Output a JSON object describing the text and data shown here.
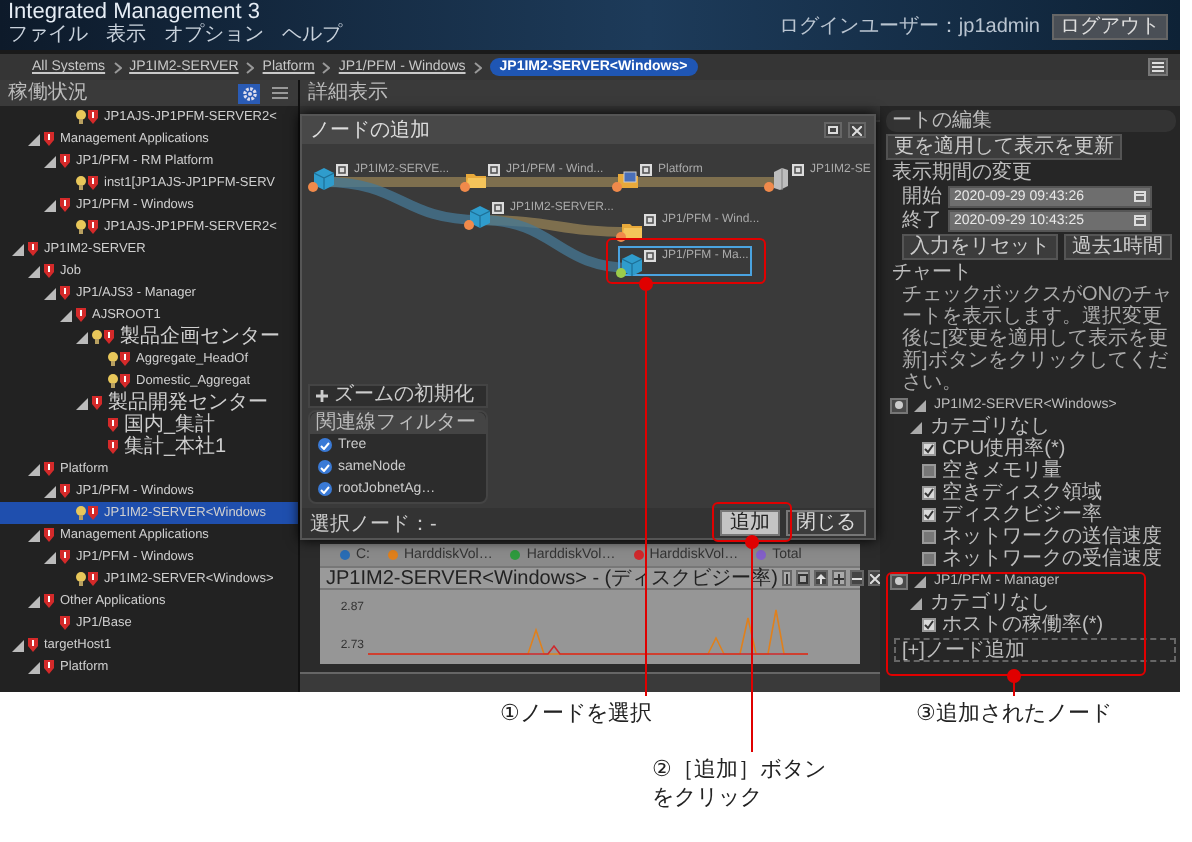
{
  "window": {
    "title": "Integrated Management 3",
    "user": "ログインユーザー：jp1admin",
    "logout": "ログアウト"
  },
  "menu": [
    "ファイル",
    "表示",
    "オプション",
    "ヘルプ"
  ],
  "breadcrumbs": [
    {
      "label": "All Systems",
      "selected": false
    },
    {
      "label": "JP1IM2-SERVER",
      "selected": false
    },
    {
      "label": "Platform",
      "selected": false
    },
    {
      "label": "JP1/PFM - Windows",
      "selected": false
    },
    {
      "label": "JP1IM2-SERVER<Windows>",
      "selected": true
    }
  ],
  "status_panel": {
    "title": "稼働状況",
    "tree": [
      {
        "children": [
          {
            "children": [
              {
                "children": [
                  {
                    "label": "JP1AJS-JP1PFM-SERVER2<",
                    "lamp": true,
                    "selected": false
                  }
                ]
              }
            ]
          },
          {
            "label": "Management Applications",
            "expanded": true,
            "lamp": false,
            "selected": false,
            "children": [
              {
                "label": "JP1/PFM - RM Platform",
                "expanded": true,
                "lamp": false,
                "selected": false,
                "children": [
                  {
                    "label": "inst1[JP1AJS-JP1PFM-SERV",
                    "lamp": true,
                    "selected": false
                  }
                ]
              },
              {
                "label": "JP1/PFM - Windows",
                "expanded": true,
                "lamp": false,
                "selected": false,
                "children": [
                  {
                    "label": "JP1AJS-JP1PFM-SERVER2<",
                    "lamp": true,
                    "selected": false
                  }
                ]
              }
            ]
          }
        ]
      },
      {
        "label": "JP1IM2-SERVER",
        "expanded": true,
        "lamp": false,
        "selected": false,
        "children": [
          {
            "label": "Job",
            "expanded": true,
            "lamp": false,
            "selected": false,
            "children": [
              {
                "label": "JP1/AJS3 - Manager",
                "expanded": true,
                "lamp": false,
                "selected": false,
                "children": [
                  {
                    "label": "AJSROOT1",
                    "expanded": true,
                    "lamp": false,
                    "selected": false,
                    "children": [
                      {
                        "label": "製品企画センター",
                        "expanded": true,
                        "lamp": true,
                        "selected": false,
                        "children": [
                          {
                            "label": "Aggregate_HeadOf",
                            "lamp": true,
                            "selected": false
                          },
                          {
                            "label": "Domestic_Aggregat",
                            "lamp": true,
                            "selected": false
                          }
                        ]
                      },
                      {
                        "label": "製品開発センター",
                        "expanded": true,
                        "lamp": false,
                        "selected": false,
                        "children": [
                          {
                            "label": "国内_集計",
                            "lamp": false,
                            "selected": false
                          },
                          {
                            "label": "集計_本社1",
                            "lamp": false,
                            "selected": false
                          }
                        ]
                      }
                    ]
                  }
                ]
              }
            ]
          },
          {
            "label": "Platform",
            "expanded": true,
            "lamp": false,
            "selected": false,
            "children": [
              {
                "label": "JP1/PFM - Windows",
                "expanded": true,
                "lamp": false,
                "selected": false,
                "children": [
                  {
                    "label": "JP1IM2-SERVER<Windows",
                    "lamp": true,
                    "selected": true
                  }
                ]
              }
            ]
          },
          {
            "label": "Management Applications",
            "expanded": true,
            "lamp": false,
            "selected": false,
            "children": [
              {
                "label": "JP1/PFM - Windows",
                "expanded": true,
                "lamp": false,
                "selected": false,
                "children": [
                  {
                    "label": "JP1IM2-SERVER<Windows>",
                    "lamp": true,
                    "selected": false
                  }
                ]
              }
            ]
          },
          {
            "label": "Other Applications",
            "expanded": true,
            "lamp": false,
            "selected": false,
            "children": [
              {
                "label": "JP1/Base",
                "lamp": false,
                "selected": false
              }
            ]
          }
        ]
      },
      {
        "label": "targetHost1",
        "expanded": true,
        "lamp": false,
        "selected": false,
        "children": [
          {
            "label": "Platform",
            "expanded": true,
            "lamp": false,
            "selected": false
          }
        ]
      }
    ]
  },
  "detail_panel": {
    "title": "詳細表示",
    "chart": {
      "legend": [
        {
          "label": "C:",
          "color": "#2a6db5"
        },
        {
          "label": "HarddiskVol…",
          "color": "#e0801c"
        },
        {
          "label": "HarddiskVol…",
          "color": "#2f9a3e"
        },
        {
          "label": "HarddiskVol…",
          "color": "#d0282c"
        },
        {
          "label": "Total",
          "color": "#8360c8"
        }
      ],
      "title": "JP1IM2-SERVER<Windows> - (ディスクビジー率)",
      "y_ticks": [
        "2.87",
        "2.73"
      ]
    }
  },
  "dialog": {
    "title": "ノードの追加",
    "nodes": [
      {
        "label": "JP1IM2-SERVE...",
        "kind": "cube",
        "color": "#f08a4b",
        "selected": false
      },
      {
        "label": "JP1/PFM - Wind...",
        "kind": "folder",
        "color": "#f08a4b",
        "selected": false
      },
      {
        "label": "Platform",
        "kind": "monitor",
        "color": "#f08a4b",
        "selected": false
      },
      {
        "label": "JP1IM2-SE",
        "kind": "server",
        "color": "#f08a4b",
        "selected": false
      },
      {
        "label": "JP1IM2-SERVER...",
        "kind": "cube",
        "color": "#f08a4b",
        "selected": false
      },
      {
        "label": "JP1/PFM - Wind...",
        "kind": "folder",
        "color": "#f08a4b",
        "selected": false
      },
      {
        "label": "JP1/PFM - Ma...",
        "kind": "cube",
        "color": "#9ccc4a",
        "selected": true
      }
    ],
    "zoom_reset": "ズームの初期化",
    "filter": {
      "title": "関連線フィルター",
      "items": [
        {
          "label": "Tree",
          "checked": true
        },
        {
          "label": "sameNode",
          "checked": true
        },
        {
          "label": "rootJobnetAg…",
          "checked": true
        }
      ]
    },
    "selected_node": "選択ノード：-",
    "buttons": [
      "追加",
      "閉じる"
    ]
  },
  "chart_editor": {
    "title": "ートの編集",
    "apply": "更を適用して表示を更新",
    "period": {
      "title": "表示期間の変更",
      "start_label": "開始",
      "start": "2020-09-29 09:43:26",
      "end_label": "終了",
      "end": "2020-09-29 10:43:25",
      "reset": "入力をリセット",
      "last_hour": "過去1時間"
    },
    "chart_title": "チャート",
    "note": "チェックボックスがONのチャートを表示します。選択変更後に[変更を適用して表示を更新]ボタンをクリックしてください。",
    "groups": [
      {
        "node": "JP1IM2-SERVER<Windows>",
        "expanded": true,
        "category": "カテゴリなし",
        "items": [
          {
            "label": "CPU使用率(*)",
            "checked": true
          },
          {
            "label": "空きメモリ量",
            "checked": false
          },
          {
            "label": "空きディスク領域",
            "checked": true
          },
          {
            "label": "ディスクビジー率",
            "checked": true
          },
          {
            "label": "ネットワークの送信速度",
            "checked": false
          },
          {
            "label": "ネットワークの受信速度",
            "checked": false
          }
        ]
      },
      {
        "node": "JP1/PFM - Manager",
        "expanded": true,
        "category": "カテゴリなし",
        "items": [
          {
            "label": "ホストの稼働率(*)",
            "checked": true
          }
        ]
      }
    ],
    "add_node": "[+]ノード追加"
  },
  "callouts": [
    {
      "lines": [
        "①ノードを選択"
      ]
    },
    {
      "lines": [
        "②［追加］ボタン",
        "をクリック"
      ]
    },
    {
      "lines": [
        "③追加されたノード"
      ]
    }
  ]
}
